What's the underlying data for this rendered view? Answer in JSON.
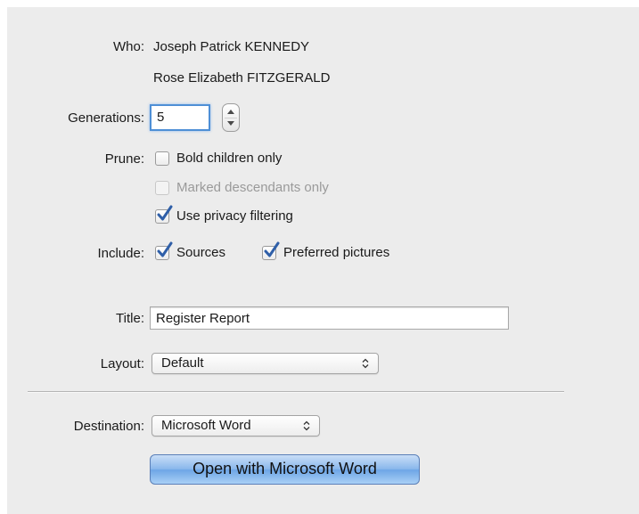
{
  "who": {
    "label": "Who:",
    "person1": "Joseph Patrick KENNEDY",
    "person2": "Rose Elizabeth FITZGERALD"
  },
  "generations": {
    "label": "Generations:",
    "value": "5"
  },
  "prune": {
    "label": "Prune:",
    "options": [
      {
        "label": "Bold children only",
        "checked": false,
        "enabled": true
      },
      {
        "label": "Marked descendants only",
        "checked": false,
        "enabled": false
      },
      {
        "label": "Use privacy filtering",
        "checked": true,
        "enabled": true
      }
    ]
  },
  "include": {
    "label": "Include:",
    "options": [
      {
        "label": "Sources",
        "checked": true
      },
      {
        "label": "Preferred pictures",
        "checked": true
      }
    ]
  },
  "title": {
    "label": "Title:",
    "value": "Register Report"
  },
  "layout": {
    "label": "Layout:",
    "selected": "Default"
  },
  "destination": {
    "label": "Destination:",
    "selected": "Microsoft Word"
  },
  "action_button": {
    "label": "Open with Microsoft Word"
  },
  "colors": {
    "panel_background": "#ececec",
    "checkmark": "#2f5fa8",
    "focus_ring": "#4e8fd6",
    "button_accent": "#8bb8ec"
  },
  "icons": {
    "stepper": "up-down-stepper-icon",
    "checkmark": "checkmark-icon",
    "popup": "up-down-chevron-icon"
  }
}
